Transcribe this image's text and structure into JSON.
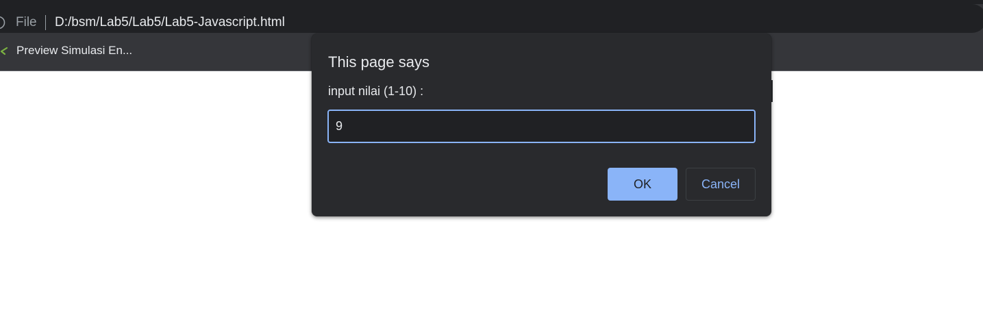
{
  "browser": {
    "address_bar": {
      "scheme_label": "File",
      "url": "D:/bsm/Lab5/Lab5/Lab5-Javascript.html",
      "info_icon": "info-circle-icon"
    },
    "bookmarks": [
      {
        "label": "Preview Simulasi En...",
        "icon": "bookmark-favicon-icon"
      }
    ]
  },
  "dialog": {
    "title": "This page says",
    "message": "input nilai (1-10) :",
    "input_value": "9",
    "ok_label": "OK",
    "cancel_label": "Cancel"
  },
  "colors": {
    "chrome_bg": "#35363a",
    "dialog_bg": "#292a2d",
    "accent": "#8ab4f8",
    "text": "#e8eaed",
    "muted_text": "#9aa0a6"
  }
}
